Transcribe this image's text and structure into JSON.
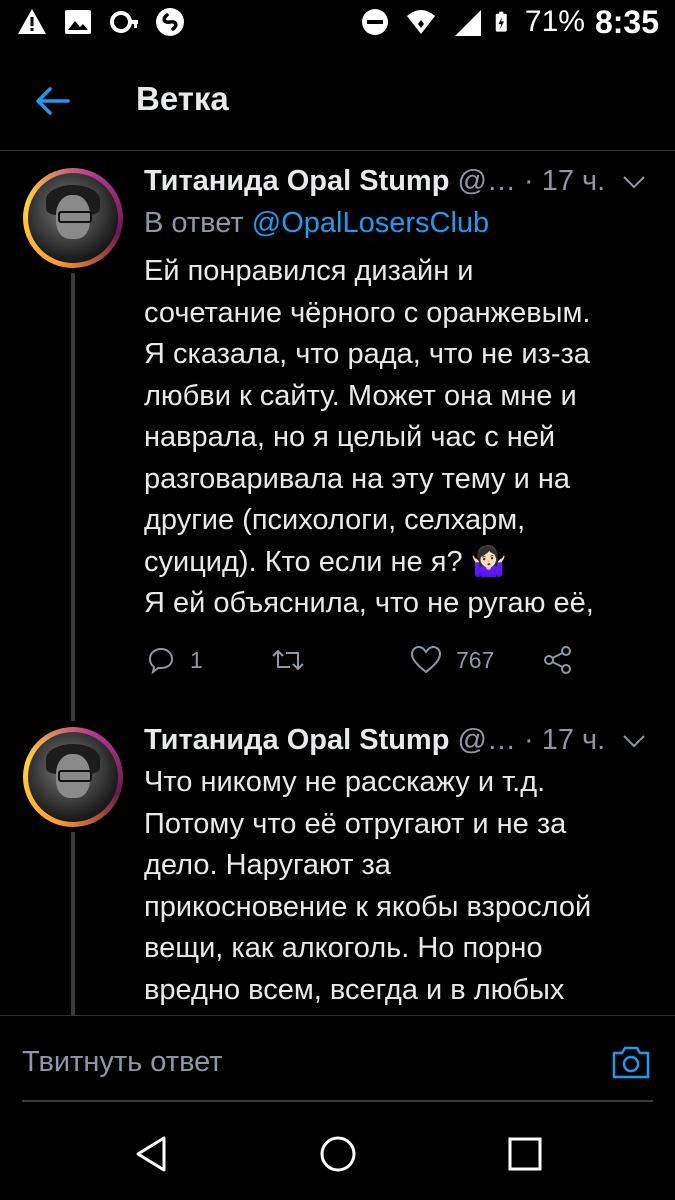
{
  "status_bar": {
    "battery": "71%",
    "time": "8:35",
    "icons_left": [
      "warning-icon",
      "image-icon",
      "key-icon",
      "shazam-icon"
    ],
    "icons_right": [
      "dnd-icon",
      "wifi-icon",
      "signal-icon",
      "battery-icon"
    ]
  },
  "header": {
    "title": "Ветка",
    "back_icon": "arrow-left-icon",
    "accent": "#1d9bf0"
  },
  "tweets": [
    {
      "name": "Титанида Opal Stump",
      "handle": "@…",
      "time": "· 17 ч.",
      "reply_prefix": "В ответ",
      "reply_to": "@OpalLosersClub",
      "text": "Ей понравился дизайн и\nсочетание чёрного с оранжевым.\nЯ сказала, что рада, что не из-за\nлюбви к сайту. Может она мне и\nнаврала, но я целый час с ней\nразговаривала на эту тему и на\nдругие (психологи, селхарм,\nсуицид). Кто если не я? 🤷🏻‍♀️\nЯ ей объяснила, что не ругаю её,",
      "replies": "1",
      "likes": "767"
    },
    {
      "name": "Титанида Opal Stump",
      "handle": "@…",
      "time": "· 17 ч.",
      "text": "Что никому не расскажу и т.д.\nПотому что её отругают и не за\nдело. Наругают за\nприкосновение к якобы взрослой\nвещи, как алкоголь. Но порно\nвредно всем, всегда и в любых"
    }
  ],
  "compose": {
    "placeholder": "Твитнуть ответ",
    "camera_icon": "camera-icon"
  },
  "nav": {
    "icons": [
      "back-triangle-icon",
      "home-circle-icon",
      "recents-square-icon"
    ]
  },
  "colors": {
    "background": "#000000",
    "text": "#e7e9ea",
    "secondary": "#8b98a5",
    "link": "#1d9bf0"
  }
}
